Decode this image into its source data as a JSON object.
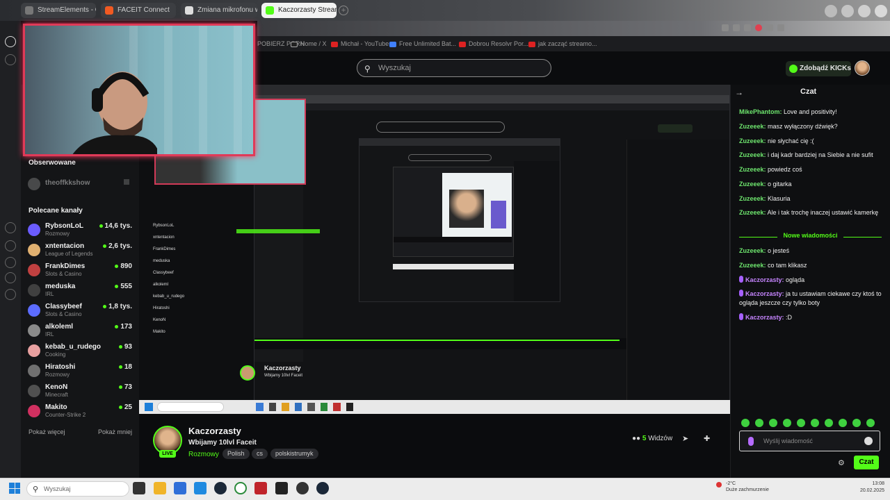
{
  "browser": {
    "tabs": [
      {
        "label": "StreamElements - Overl",
        "active": false
      },
      {
        "label": "FACEIT Connect",
        "active": false
      },
      {
        "label": "Zmiana mikrofonu w OS",
        "active": false
      },
      {
        "label": "Kaczorzasty Stream",
        "active": true
      }
    ],
    "new_tab_label": "+",
    "bookmarks": [
      "POBIERZ PORN",
      "Home / X",
      "Michał - YouTube",
      "Free Unlimited Bat...",
      "Dobrou Resolvr Por...",
      "jak zacząć streamo..."
    ]
  },
  "kick": {
    "search_placeholder": "Wyszukaj",
    "get_kicks_label": "Zdobądź KICKs",
    "sidebar": {
      "followed_title": "Obserwowane",
      "followed": [
        {
          "name": "theoffkkshow"
        }
      ],
      "recommended_title": "Polecane kanały",
      "channels": [
        {
          "name": "RybsonLoL",
          "category": "Rozmowy",
          "viewers": "14,6 tys.",
          "color": "#6b5cff"
        },
        {
          "name": "xntentacion",
          "category": "League of Legends",
          "viewers": "2,6 tys.",
          "color": "#e0b070"
        },
        {
          "name": "FrankDimes",
          "category": "Slots & Casino",
          "viewers": "890",
          "color": "#c04040"
        },
        {
          "name": "meduska",
          "category": "IRL",
          "viewers": "555",
          "color": "#404040"
        },
        {
          "name": "Classybeef",
          "category": "Slots & Casino",
          "viewers": "1,8 tys.",
          "color": "#5c6cff"
        },
        {
          "name": "alkoleml",
          "category": "IRL",
          "viewers": "173",
          "color": "#8a8a8a"
        },
        {
          "name": "kebab_u_rudego",
          "category": "Cooking",
          "viewers": "93",
          "color": "#e8a0a0"
        },
        {
          "name": "Hiratoshi",
          "category": "Rozmowy",
          "viewers": "18",
          "color": "#707070"
        },
        {
          "name": "KenoN",
          "category": "Minecraft",
          "viewers": "73",
          "color": "#505050"
        },
        {
          "name": "Makito",
          "category": "Counter-Strike 2",
          "viewers": "25",
          "color": "#d03060"
        }
      ],
      "show_more": "Pokaż więcej",
      "show_less": "Pokaż mniej"
    },
    "stream": {
      "streamer": "Kaczorzasty",
      "title": "Wbijamy 10lvl Faceit",
      "category": "Rozmowy",
      "tags": [
        "Polish",
        "cs",
        "polskistrumyk"
      ],
      "live_badge": "LIVE",
      "viewers_count": "5",
      "viewers_label": "Widzów"
    },
    "chat": {
      "header": "Czat",
      "messages": [
        {
          "user": "MikePhantom",
          "text": "Love and positivity!",
          "color": "green",
          "badge": false
        },
        {
          "user": "Zuzeeek",
          "text": "masz wyłączony dźwięk?",
          "color": "green",
          "badge": false
        },
        {
          "user": "Zuzeeek",
          "text": "nie słychać cię :(",
          "color": "green",
          "badge": false
        },
        {
          "user": "Zuzeeek",
          "text": "i daj kadr bardziej na Siebie a nie sufit",
          "color": "green",
          "badge": false
        },
        {
          "user": "Zuzeeek",
          "text": "powiedz coś",
          "color": "green",
          "badge": false
        },
        {
          "user": "Zuzeeek",
          "text": "o gitarka",
          "color": "green",
          "badge": false
        },
        {
          "user": "Zuzeeek",
          "text": "Klasuria",
          "color": "green",
          "badge": false
        },
        {
          "user": "Zuzeeek",
          "text": "Ale i tak trochę inaczej ustawić kamerkę",
          "color": "green",
          "badge": false
        }
      ],
      "new_messages_label": "Nowe wiadomości",
      "new_messages": [
        {
          "user": "Zuzeeek",
          "text": "o jesteś",
          "color": "green",
          "badge": false
        },
        {
          "user": "Zuzeeek",
          "text": "co tam klikasz",
          "color": "green",
          "badge": false
        },
        {
          "user": "Kaczorzasty",
          "text": "ogląda",
          "color": "purple",
          "badge": true
        },
        {
          "user": "Kaczorzasty",
          "text": "ja tu ustawiam ciekawe czy ktoś to ogląda jeszcze czy tylko boty",
          "color": "purple",
          "badge": true
        },
        {
          "user": "Kaczorzasty",
          "text": ":D",
          "color": "purple",
          "badge": true
        }
      ],
      "input_placeholder": "Wyślij wiadomość",
      "send_label": "Czat"
    }
  },
  "taskbar": {
    "search_placeholder": "Wyszukaj",
    "weather": "-2°C",
    "weather_desc": "Duże zachmurzenie",
    "time": "13:08",
    "date": "20.02.2025"
  },
  "colors": {
    "kick_green": "#53fc18",
    "webcam_border": "#e03a58",
    "chat_purple": "#c685ff"
  }
}
